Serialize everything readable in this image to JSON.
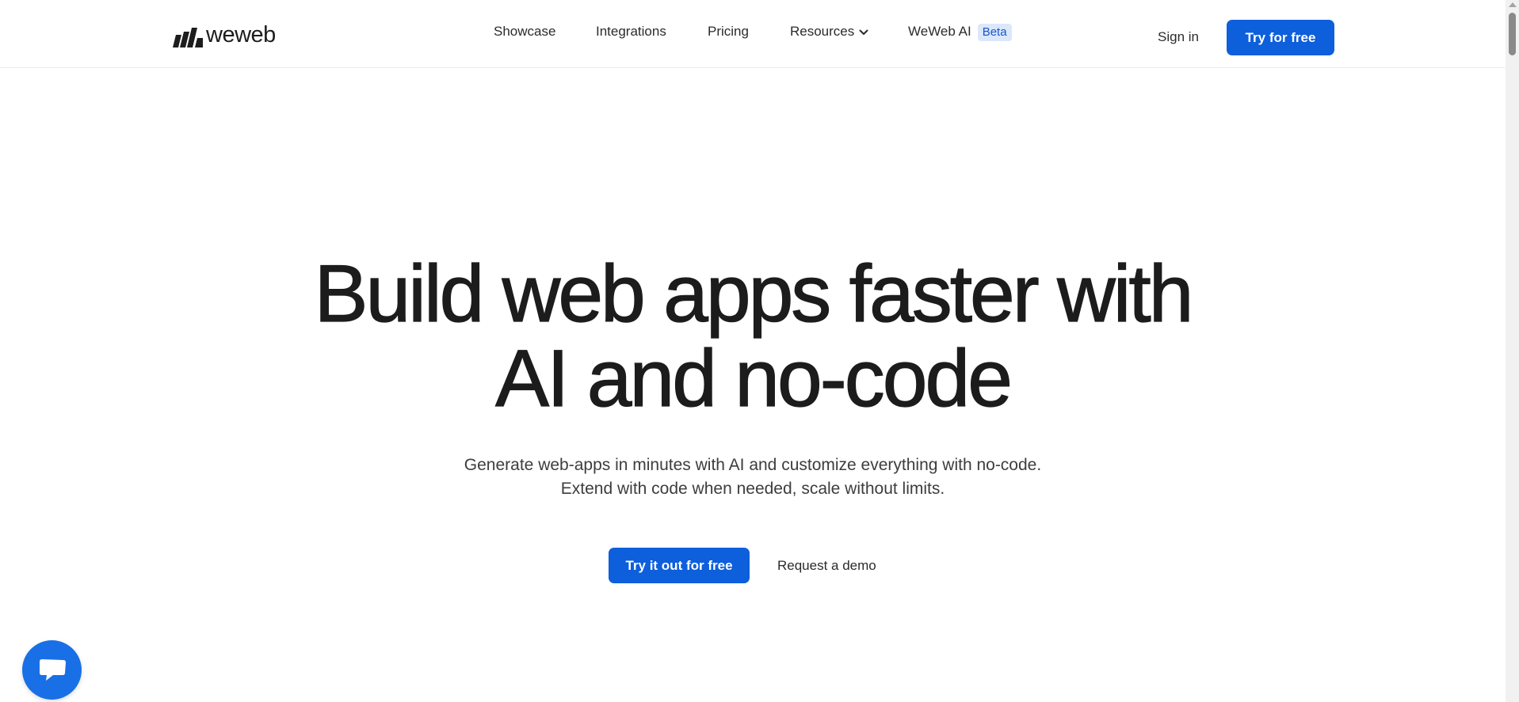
{
  "brand": {
    "name": "weweb"
  },
  "nav": {
    "items": [
      {
        "label": "Showcase"
      },
      {
        "label": "Integrations"
      },
      {
        "label": "Pricing"
      },
      {
        "label": "Resources"
      },
      {
        "label": "WeWeb AI",
        "badge": "Beta"
      }
    ],
    "sign_in": "Sign in",
    "cta": "Try for free"
  },
  "hero": {
    "title_line1": "Build web apps faster with",
    "title_line2": "AI and no-code",
    "subtitle_line1": "Generate web-apps in minutes with AI and customize everything with no-code.",
    "subtitle_line2": "Extend with code when needed, scale without limits.",
    "primary_cta": "Try it out for free",
    "secondary_cta": "Request a demo"
  },
  "colors": {
    "accent": "#0d5fdc",
    "badge_bg": "#dbe7fb",
    "badge_text": "#1a56c8",
    "chat_bubble": "#1970e6"
  },
  "icons": {
    "logo": "weweb-logo-icon",
    "resources_dropdown": "chevron-down-icon",
    "chat": "chat-icon"
  }
}
